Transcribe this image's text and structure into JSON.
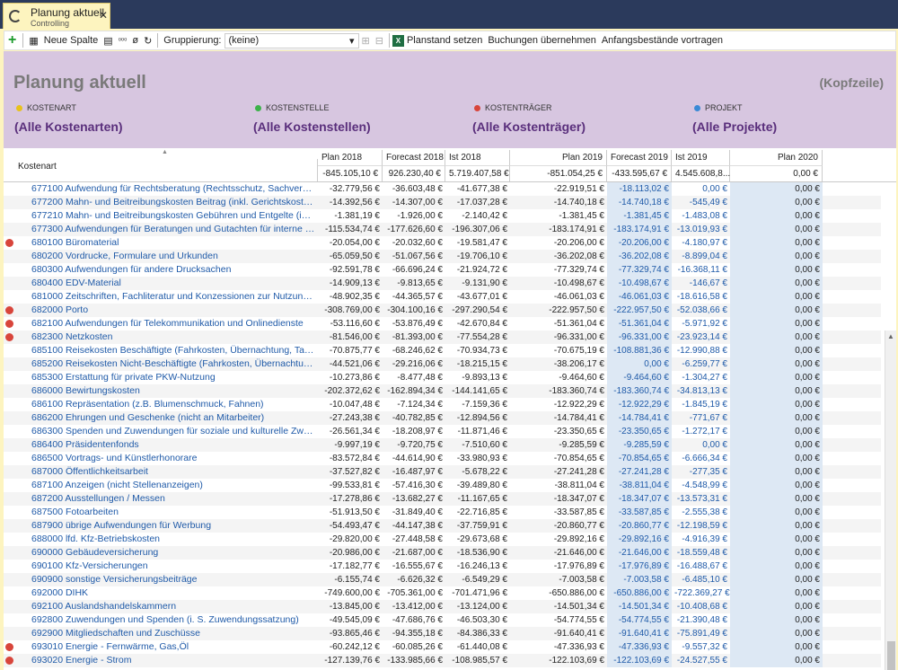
{
  "tab": {
    "title": "Planung aktuell",
    "subtitle": "Controlling",
    "close": "✕"
  },
  "toolbar": {
    "new_column": "Neue Spalte",
    "grouping_label": "Gruppierung:",
    "grouping_value": "(keine)",
    "plan_set": "Planstand setzen",
    "take_bookings": "Buchungen übernehmen",
    "carry_opening": "Anfangsbestände vortragen"
  },
  "header": {
    "title": "Planung aktuell",
    "kopfzeile": "(Kopfzeile)",
    "dims": [
      {
        "label": "KOSTENART",
        "value": "(Alle Kostenarten)",
        "color": "#e8c21c"
      },
      {
        "label": "KOSTENSTELLE",
        "value": "(Alle Kostenstellen)",
        "color": "#3cb24a"
      },
      {
        "label": "KOSTENTRÄGER",
        "value": "(Alle Kostenträger)",
        "color": "#d8453b"
      },
      {
        "label": "PROJEKT",
        "value": "(Alle Projekte)",
        "color": "#3a8ad6"
      }
    ]
  },
  "grid": {
    "first_col": "Kostenart",
    "columns": [
      "Plan 2018",
      "Forecast 2018",
      "Ist 2018",
      "Plan 2019",
      "Forecast 2019",
      "Ist 2019",
      "Plan 2020"
    ],
    "totals": [
      "-845.105,10 €",
      "926.230,40 €",
      "5.719.407,58 €",
      "-851.054,25 €",
      "-433.595,67 €",
      "4.545.608,8...",
      "0,00 €"
    ],
    "rows": [
      {
        "name": "677100 Aufwendung für Rechtsberatung (Rechtsschutz, Sachverständi...",
        "v": [
          "-32.779,56 €",
          "-36.603,48 €",
          "-41.677,38 €",
          "-22.919,51 €",
          "-18.113,02 €",
          "0,00 €",
          "0,00 €"
        ],
        "dot": false
      },
      {
        "name": "677200 Mahn- und Beitreibungskosten Beitrag (inkl. Gerichtskosten)",
        "v": [
          "-14.392,56 €",
          "-14.307,00 €",
          "-17.037,28 €",
          "-14.740,18 €",
          "-14.740,18 €",
          "-545,49 €",
          "0,00 €"
        ],
        "dot": false
      },
      {
        "name": "677210 Mahn- und Beitreibungskosten Gebühren und Entgelte (inkl....",
        "v": [
          "-1.381,19 €",
          "-1.926,00 €",
          "-2.140,42 €",
          "-1.381,45 €",
          "-1.381,45 €",
          "-1.483,08 €",
          "0,00 €"
        ],
        "dot": false
      },
      {
        "name": "677300 Aufwendungen für Beratungen und Gutachten für interne Zwe...",
        "v": [
          "-115.534,74 €",
          "-177.626,60 €",
          "-196.307,06 €",
          "-183.174,91 €",
          "-183.174,91 €",
          "-13.019,93 €",
          "0,00 €"
        ],
        "dot": false
      },
      {
        "name": "680100 Büromaterial",
        "v": [
          "-20.054,00 €",
          "-20.032,60 €",
          "-19.581,47 €",
          "-20.206,00 €",
          "-20.206,00 €",
          "-4.180,97 €",
          "0,00 €"
        ],
        "dot": true
      },
      {
        "name": "680200 Vordrucke, Formulare und Urkunden",
        "v": [
          "-65.059,50 €",
          "-51.067,56 €",
          "-19.706,10 €",
          "-36.202,08 €",
          "-36.202,08 €",
          "-8.899,04 €",
          "0,00 €"
        ],
        "dot": false
      },
      {
        "name": "680300 Aufwendungen für andere Drucksachen",
        "v": [
          "-92.591,78 €",
          "-66.696,24 €",
          "-21.924,72 €",
          "-77.329,74 €",
          "-77.329,74 €",
          "-16.368,11 €",
          "0,00 €"
        ],
        "dot": false
      },
      {
        "name": "680400 EDV-Material",
        "v": [
          "-14.909,13 €",
          "-9.813,65 €",
          "-9.131,90 €",
          "-10.498,67 €",
          "-10.498,67 €",
          "-146,67 €",
          "0,00 €"
        ],
        "dot": false
      },
      {
        "name": "681000 Zeitschriften, Fachliteratur und Konzessionen zur Nutzung von...",
        "v": [
          "-48.902,35 €",
          "-44.365,57 €",
          "-43.677,01 €",
          "-46.061,03 €",
          "-46.061,03 €",
          "-18.616,58 €",
          "0,00 €"
        ],
        "dot": false
      },
      {
        "name": "682000 Porto",
        "v": [
          "-308.769,00 €",
          "-304.100,16 €",
          "-297.290,54 €",
          "-222.957,50 €",
          "-222.957,50 €",
          "-52.038,66 €",
          "0,00 €"
        ],
        "dot": true
      },
      {
        "name": "682100 Aufwendungen für Telekommunikation und Onlinedienste",
        "v": [
          "-53.116,60 €",
          "-53.876,49 €",
          "-42.670,84 €",
          "-51.361,04 €",
          "-51.361,04 €",
          "-5.971,92 €",
          "0,00 €"
        ],
        "dot": true
      },
      {
        "name": "682300 Netzkosten",
        "v": [
          "-81.546,00 €",
          "-81.393,00 €",
          "-77.554,28 €",
          "-96.331,00 €",
          "-96.331,00 €",
          "-23.923,14 €",
          "0,00 €"
        ],
        "dot": true
      },
      {
        "name": "685100 Reisekosten Beschäftigte (Fahrkosten, Übernachtung, Tagegeld)",
        "v": [
          "-70.875,77 €",
          "-68.246,62 €",
          "-70.934,73 €",
          "-70.675,19 €",
          "-108.881,36 €",
          "-12.990,88 €",
          "0,00 €"
        ],
        "dot": false
      },
      {
        "name": "685200 Reisekosten Nicht-Beschäftigte (Fahrkosten, Übernachtung, Ta...",
        "v": [
          "-44.521,06 €",
          "-29.216,06 €",
          "-18.215,15 €",
          "-38.206,17 €",
          "0,00 €",
          "-6.259,77 €",
          "0,00 €"
        ],
        "dot": false
      },
      {
        "name": "685300 Erstattung für private PKW-Nutzung",
        "v": [
          "-10.273,86 €",
          "-8.477,48 €",
          "-9.893,13 €",
          "-9.464,60 €",
          "-9.464,60 €",
          "-1.304,27 €",
          "0,00 €"
        ],
        "dot": false
      },
      {
        "name": "686000 Bewirtungskosten",
        "v": [
          "-202.372,62 €",
          "-162.894,34 €",
          "-144.141,65 €",
          "-183.360,74 €",
          "-183.360,74 €",
          "-34.813,13 €",
          "0,00 €"
        ],
        "dot": false
      },
      {
        "name": "686100 Repräsentation (z.B. Blumenschmuck, Fahnen)",
        "v": [
          "-10.047,48 €",
          "-7.124,34 €",
          "-7.159,36 €",
          "-12.922,29 €",
          "-12.922,29 €",
          "-1.845,19 €",
          "0,00 €"
        ],
        "dot": false
      },
      {
        "name": "686200 Ehrungen und Geschenke (nicht an Mitarbeiter)",
        "v": [
          "-27.243,38 €",
          "-40.782,85 €",
          "-12.894,56 €",
          "-14.784,41 €",
          "-14.784,41 €",
          "-771,67 €",
          "0,00 €"
        ],
        "dot": false
      },
      {
        "name": "686300 Spenden und Zuwendungen für soziale und kulturelle Zwecke...",
        "v": [
          "-26.561,34 €",
          "-18.208,97 €",
          "-11.871,46 €",
          "-23.350,65 €",
          "-23.350,65 €",
          "-1.272,17 €",
          "0,00 €"
        ],
        "dot": false
      },
      {
        "name": "686400 Präsidentenfonds",
        "v": [
          "-9.997,19 €",
          "-9.720,75 €",
          "-7.510,60 €",
          "-9.285,59 €",
          "-9.285,59 €",
          "0,00 €",
          "0,00 €"
        ],
        "dot": false
      },
      {
        "name": "686500 Vortrags- und Künstlerhonorare",
        "v": [
          "-83.572,84 €",
          "-44.614,90 €",
          "-33.980,93 €",
          "-70.854,65 €",
          "-70.854,65 €",
          "-6.666,34 €",
          "0,00 €"
        ],
        "dot": false
      },
      {
        "name": "687000 Öffentlichkeitsarbeit",
        "v": [
          "-37.527,82 €",
          "-16.487,97 €",
          "-5.678,22 €",
          "-27.241,28 €",
          "-27.241,28 €",
          "-277,35 €",
          "0,00 €"
        ],
        "dot": false
      },
      {
        "name": "687100 Anzeigen (nicht Stellenanzeigen)",
        "v": [
          "-99.533,81 €",
          "-57.416,30 €",
          "-39.489,80 €",
          "-38.811,04 €",
          "-38.811,04 €",
          "-4.548,99 €",
          "0,00 €"
        ],
        "dot": false
      },
      {
        "name": "687200 Ausstellungen / Messen",
        "v": [
          "-17.278,86 €",
          "-13.682,27 €",
          "-11.167,65 €",
          "-18.347,07 €",
          "-18.347,07 €",
          "-13.573,31 €",
          "0,00 €"
        ],
        "dot": false
      },
      {
        "name": "687500 Fotoarbeiten",
        "v": [
          "-51.913,50 €",
          "-31.849,40 €",
          "-22.716,85 €",
          "-33.587,85 €",
          "-33.587,85 €",
          "-2.555,38 €",
          "0,00 €"
        ],
        "dot": false
      },
      {
        "name": "687900 übrige Aufwendungen für Werbung",
        "v": [
          "-54.493,47 €",
          "-44.147,38 €",
          "-37.759,91 €",
          "-20.860,77 €",
          "-20.860,77 €",
          "-12.198,59 €",
          "0,00 €"
        ],
        "dot": false
      },
      {
        "name": "688000 lfd. Kfz-Betriebskosten",
        "v": [
          "-29.820,00 €",
          "-27.448,58 €",
          "-29.673,68 €",
          "-29.892,16 €",
          "-29.892,16 €",
          "-4.916,39 €",
          "0,00 €"
        ],
        "dot": false
      },
      {
        "name": "690000 Gebäudeversicherung",
        "v": [
          "-20.986,00 €",
          "-21.687,00 €",
          "-18.536,90 €",
          "-21.646,00 €",
          "-21.646,00 €",
          "-18.559,48 €",
          "0,00 €"
        ],
        "dot": false
      },
      {
        "name": "690100 Kfz-Versicherungen",
        "v": [
          "-17.182,77 €",
          "-16.555,67 €",
          "-16.246,13 €",
          "-17.976,89 €",
          "-17.976,89 €",
          "-16.488,67 €",
          "0,00 €"
        ],
        "dot": false
      },
      {
        "name": "690900 sonstige Versicherungsbeiträge",
        "v": [
          "-6.155,74 €",
          "-6.626,32 €",
          "-6.549,29 €",
          "-7.003,58 €",
          "-7.003,58 €",
          "-6.485,10 €",
          "0,00 €"
        ],
        "dot": false
      },
      {
        "name": "692000 DIHK",
        "v": [
          "-749.600,00 €",
          "-705.361,00 €",
          "-701.471,96 €",
          "-650.886,00 €",
          "-650.886,00 €",
          "-722.369,27 €",
          "0,00 €"
        ],
        "dot": false
      },
      {
        "name": "692100 Auslandshandelskammern",
        "v": [
          "-13.845,00 €",
          "-13.412,00 €",
          "-13.124,00 €",
          "-14.501,34 €",
          "-14.501,34 €",
          "-10.408,68 €",
          "0,00 €"
        ],
        "dot": false
      },
      {
        "name": "692800 Zuwendungen und Spenden (i. S. Zuwendungssatzung)",
        "v": [
          "-49.545,09 €",
          "-47.686,76 €",
          "-46.503,30 €",
          "-54.774,55 €",
          "-54.774,55 €",
          "-21.390,48 €",
          "0,00 €"
        ],
        "dot": false
      },
      {
        "name": "692900 Mitgliedschaften und Zuschüsse",
        "v": [
          "-93.865,46 €",
          "-94.355,18 €",
          "-84.386,33 €",
          "-91.640,41 €",
          "-91.640,41 €",
          "-75.891,49 €",
          "0,00 €"
        ],
        "dot": false
      },
      {
        "name": "693010 Energie - Fernwärme, Gas,Öl",
        "v": [
          "-60.242,12 €",
          "-60.085,26 €",
          "-61.440,08 €",
          "-47.336,93 €",
          "-47.336,93 €",
          "-9.557,32 €",
          "0,00 €"
        ],
        "dot": true
      },
      {
        "name": "693020 Energie - Strom",
        "v": [
          "-127.139,76 €",
          "-133.985,66 €",
          "-108.985,57 €",
          "-122.103,69 €",
          "-122.103,69 €",
          "-24.527,55 €",
          "0,00 €"
        ],
        "dot": true
      }
    ]
  }
}
